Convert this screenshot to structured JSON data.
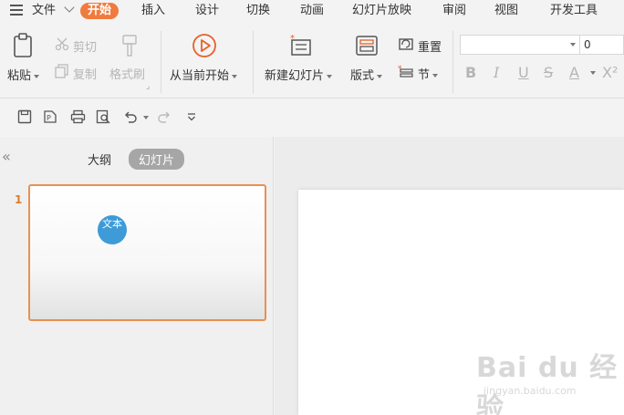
{
  "menubar": {
    "file": "文件",
    "tabs": [
      "开始",
      "插入",
      "设计",
      "切换",
      "动画",
      "幻灯片放映",
      "审阅",
      "视图",
      "开发工具"
    ]
  },
  "ribbon": {
    "paste": "粘贴",
    "cut": "剪切",
    "copy": "复制",
    "format_painter": "格式刷",
    "play_from_current": "从当前开始",
    "new_slide": "新建幻灯片",
    "layout": "版式",
    "reset": "重置",
    "section": "节",
    "font_size": "0",
    "format_buttons": [
      "B",
      "I",
      "U",
      "S",
      "A"
    ]
  },
  "panel": {
    "tab_outline": "大纲",
    "tab_slides": "幻灯片",
    "slide_number": "1",
    "badge_text": "文本"
  },
  "watermark": {
    "brand": "Bai du 经验",
    "url": "jingyan.baidu.com"
  },
  "colors": {
    "accent": "#f07b3f",
    "badge": "#3e9bd8"
  }
}
